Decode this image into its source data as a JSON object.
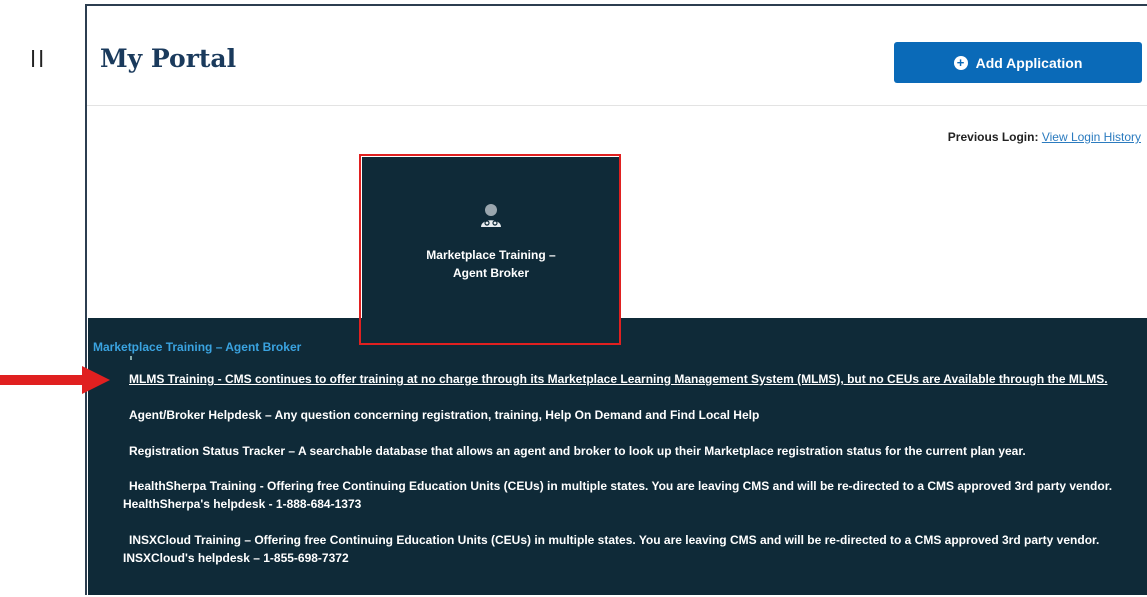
{
  "stray_text": "ll",
  "header": {
    "title": "My Portal",
    "add_button_label": "Add Application",
    "add_button_icon": "plus-circle-icon"
  },
  "login": {
    "label": "Previous Login:",
    "link": "View Login History"
  },
  "tile": {
    "icon": "user-doctor-icon",
    "title": "Marketplace Training –\nAgent Broker"
  },
  "panel": {
    "title": "Marketplace Training – Agent Broker",
    "items": [
      {
        "text": "MLMS Training - CMS continues to offer training at no charge through its Marketplace Learning Management System (MLMS), but no CEUs are Available through the MLMS."
      },
      {
        "text": "Agent/Broker Helpdesk – Any question concerning registration, training, Help On Demand and Find Local Help"
      },
      {
        "text": "Registration Status Tracker – A searchable database that allows an agent and broker to look up their Marketplace registration status for the current plan year."
      },
      {
        "text": "HealthSherpa Training - Offering free Continuing Education Units (CEUs) in multiple states. You are leaving CMS and will be re-directed to a CMS approved 3rd party vendor.",
        "sub": "HealthSherpa's helpdesk - 1-888-684-1373"
      },
      {
        "text": "INSXCloud Training – Offering free Continuing Education Units (CEUs) in multiple states. You are leaving CMS and will be re-directed to a CMS approved 3rd party vendor.",
        "sub": "INSXCloud's helpdesk – 1-855-698-7372"
      }
    ]
  },
  "colors": {
    "brand_navy": "#1a3a5c",
    "button_blue": "#0a6ab8",
    "panel_bg": "#0f2a38",
    "link_blue": "#2b7bbf",
    "panel_title_blue": "#3aa3e0",
    "highlight_red": "#e02020"
  }
}
